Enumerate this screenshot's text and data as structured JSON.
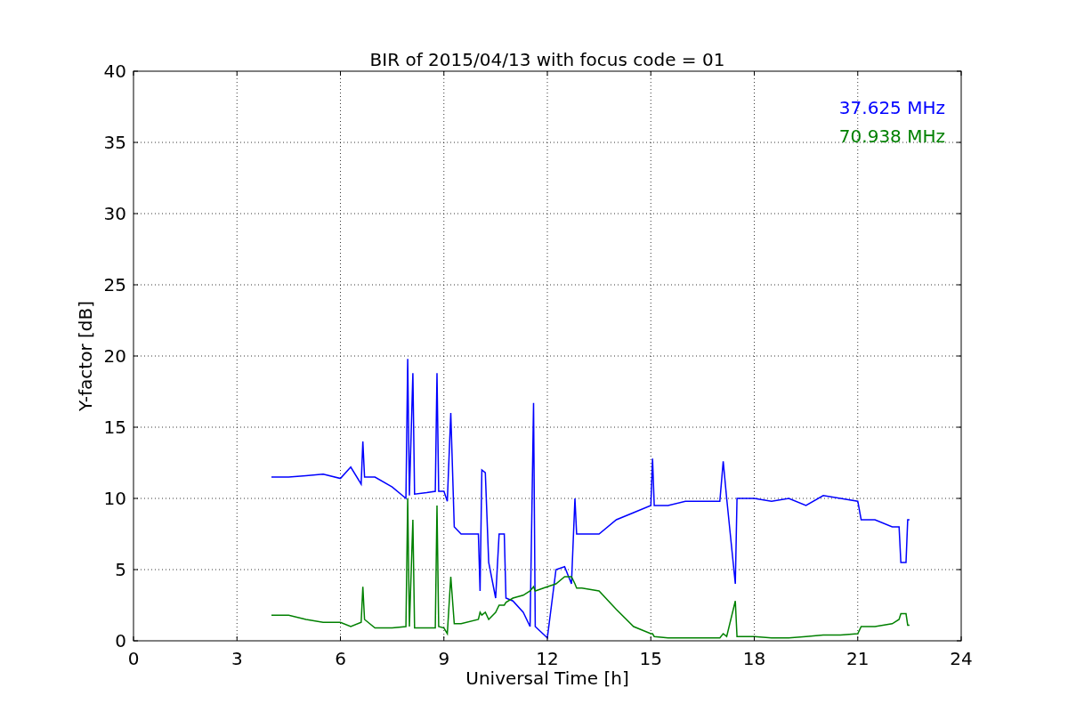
{
  "chart_data": {
    "type": "line",
    "title": "BIR of 2015/04/13 with focus code = 01",
    "xlabel": "Universal Time [h]",
    "ylabel": "Y-factor [dB]",
    "grid": true,
    "xlim": [
      0,
      24
    ],
    "ylim": [
      0,
      40
    ],
    "xticks": [
      0,
      3,
      6,
      9,
      12,
      15,
      18,
      21,
      24
    ],
    "yticks": [
      0,
      5,
      10,
      15,
      20,
      25,
      30,
      35,
      40
    ],
    "x": [
      4.0,
      4.5,
      5.0,
      5.5,
      6.0,
      6.3,
      6.6,
      6.65,
      6.7,
      7.0,
      7.5,
      7.9,
      7.95,
      8.0,
      8.1,
      8.15,
      8.5,
      8.75,
      8.8,
      8.85,
      9.0,
      9.1,
      9.2,
      9.3,
      9.5,
      10.0,
      10.05,
      10.1,
      10.2,
      10.3,
      10.5,
      10.6,
      10.75,
      10.8,
      11.0,
      11.3,
      11.5,
      11.6,
      11.65,
      12.0,
      12.25,
      12.5,
      12.7,
      12.8,
      12.85,
      13.0,
      13.5,
      14.0,
      14.5,
      15.0,
      15.05,
      15.1,
      15.5,
      16.0,
      16.5,
      17.0,
      17.1,
      17.2,
      17.45,
      17.5,
      18.0,
      18.5,
      19.0,
      19.5,
      20.0,
      20.5,
      21.0,
      21.1,
      21.5,
      22.0,
      22.2,
      22.25,
      22.4,
      22.45,
      22.5
    ],
    "series": [
      {
        "name": "37.625 MHz",
        "color": "#0000ff",
        "values": [
          11.5,
          11.5,
          11.6,
          11.7,
          11.4,
          12.2,
          11.0,
          14.0,
          11.5,
          11.5,
          10.8,
          10.0,
          19.8,
          10.2,
          18.8,
          10.3,
          10.4,
          10.5,
          18.8,
          10.5,
          10.5,
          9.8,
          16.0,
          8.0,
          7.5,
          7.5,
          3.5,
          12.0,
          11.8,
          5.5,
          3.0,
          7.5,
          7.5,
          3.0,
          2.8,
          2.0,
          1.0,
          16.7,
          1.0,
          0.2,
          5.0,
          5.2,
          4.0,
          10.0,
          7.5,
          7.5,
          7.5,
          8.5,
          9.0,
          9.5,
          12.8,
          9.5,
          9.5,
          9.8,
          9.8,
          9.8,
          12.6,
          10.0,
          4.0,
          10.0,
          10.0,
          9.8,
          10.0,
          9.5,
          10.2,
          10.0,
          9.8,
          8.5,
          8.5,
          8.0,
          8.0,
          5.5,
          5.5,
          8.5,
          8.5
        ]
      },
      {
        "name": "70.938 MHz",
        "color": "#008000",
        "values": [
          1.8,
          1.8,
          1.5,
          1.3,
          1.3,
          1.0,
          1.3,
          3.8,
          1.5,
          0.9,
          0.9,
          1.0,
          10.0,
          1.0,
          8.5,
          0.9,
          0.9,
          0.9,
          9.5,
          1.0,
          0.9,
          0.5,
          4.5,
          1.2,
          1.2,
          1.5,
          2.0,
          1.8,
          2.0,
          1.5,
          2.0,
          2.5,
          2.5,
          2.7,
          3.0,
          3.2,
          3.5,
          3.8,
          3.5,
          3.8,
          4.0,
          4.5,
          4.5,
          4.0,
          3.7,
          3.7,
          3.5,
          2.2,
          1.0,
          0.5,
          0.5,
          0.3,
          0.2,
          0.2,
          0.2,
          0.2,
          0.5,
          0.3,
          2.8,
          0.3,
          0.3,
          0.2,
          0.2,
          0.3,
          0.4,
          0.4,
          0.5,
          1.0,
          1.0,
          1.2,
          1.5,
          1.9,
          1.9,
          1.1,
          1.1
        ]
      }
    ]
  }
}
